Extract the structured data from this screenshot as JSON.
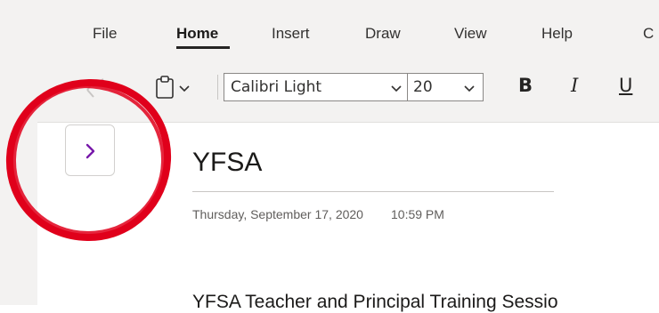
{
  "ribbon": {
    "tabs": [
      {
        "label": "File"
      },
      {
        "label": "Home",
        "active": true
      },
      {
        "label": "Insert"
      },
      {
        "label": "Draw"
      },
      {
        "label": "View"
      },
      {
        "label": "Help"
      },
      {
        "label": "C"
      }
    ],
    "font_name": "Calibri Light",
    "font_size": "20",
    "bold_label": "B",
    "italic_label": "I",
    "underline_label": "U"
  },
  "page": {
    "title": "YFSA",
    "date": "Thursday, September 17, 2020",
    "time": "10:59 PM",
    "body_text": "YFSA Teacher and Principal Training Sessio"
  },
  "icons": {
    "undo": "undo-arrow-icon",
    "paste": "clipboard-icon",
    "expand": "chevron-right-icon"
  },
  "colors": {
    "accent": "#7719aa",
    "annotation": "#e0001b",
    "ribbon_bg": "#f3f2f1"
  }
}
